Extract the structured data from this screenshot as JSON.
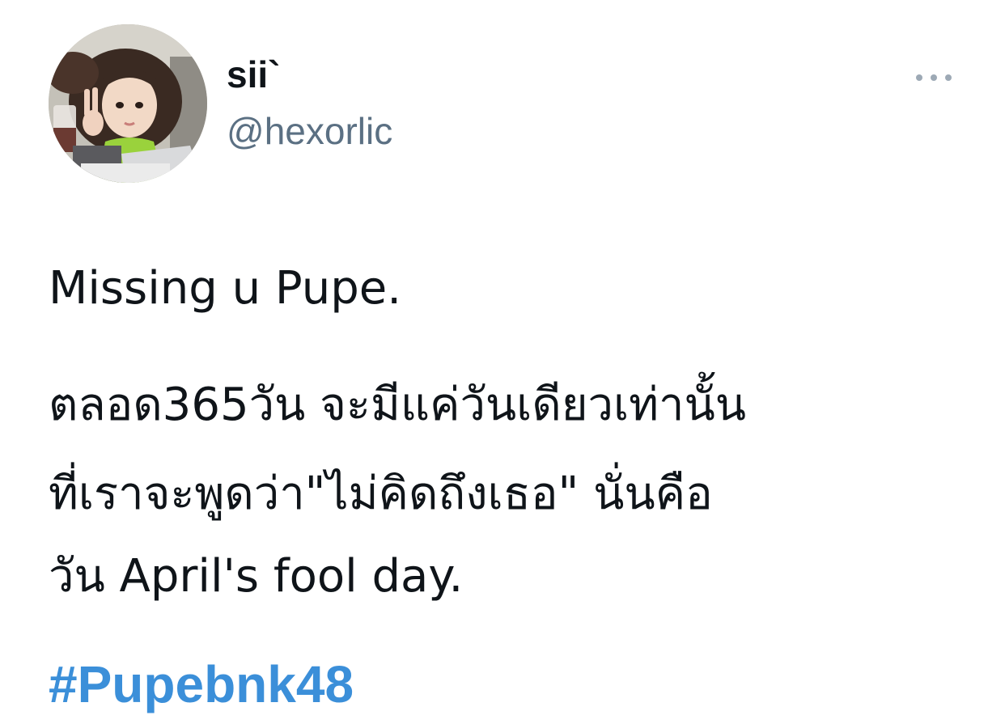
{
  "user": {
    "display_name": "sii`",
    "handle": "@hexorlic",
    "avatar_icon": "profile-photo"
  },
  "menu": {
    "icon": "more-dots-icon"
  },
  "tweet": {
    "lines": [
      "Missing u Pupe.",
      "ตลอด365วัน จะมีแค่วันเดียวเท่านั้น",
      "ที่เราจะพูดว่า\"ไม่คิดถึงเธอ\" นั่นคือ",
      "วัน April's fool day."
    ],
    "hashtag": "#Pupebnk48"
  },
  "colors": {
    "text": "#0f1419",
    "secondary": "#5b7083",
    "link": "#3b8fd9"
  }
}
